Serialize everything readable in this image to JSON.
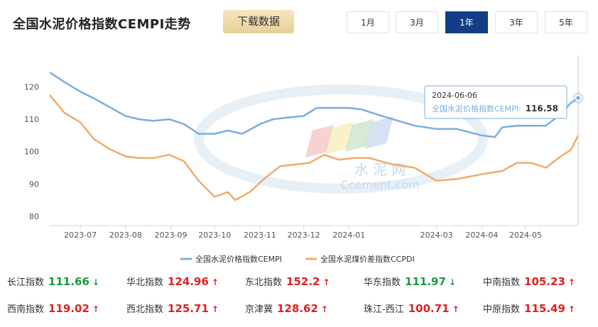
{
  "header": {
    "title": "全国水泥价格指数CEMPI走势",
    "download_label": "下载数据",
    "ranges": [
      "1月",
      "3月",
      "1年",
      "3年",
      "5年"
    ],
    "active_range": "1年"
  },
  "colors": {
    "cempi": "#7aaee0",
    "ccpdi": "#f0ac6c",
    "up": "#e02020",
    "down": "#1a9a3c",
    "accent": "#123e85"
  },
  "chart_data": {
    "type": "line",
    "ylim": [
      78,
      128
    ],
    "yticks": [
      80,
      90,
      100,
      110,
      120
    ],
    "xticks": [
      "2023-07",
      "2023-08",
      "2023-09",
      "2023-10",
      "2023-11",
      "2023-12",
      "2024-01",
      "2024-03",
      "2024-04",
      "2024-05"
    ],
    "series": [
      {
        "name": "全国水泥价格指数CEMPI",
        "color": "#7aaee0",
        "points": [
          [
            "2023-06-10",
            124.5
          ],
          [
            "2023-06-20",
            121.5
          ],
          [
            "2023-07-01",
            118.5
          ],
          [
            "2023-07-10",
            116.5
          ],
          [
            "2023-07-20",
            114
          ],
          [
            "2023-08-01",
            111
          ],
          [
            "2023-08-10",
            110
          ],
          [
            "2023-08-20",
            109.5
          ],
          [
            "2023-08-31",
            110
          ],
          [
            "2023-09-10",
            108.5
          ],
          [
            "2023-09-20",
            105.5
          ],
          [
            "2023-10-01",
            105.5
          ],
          [
            "2023-10-10",
            106.5
          ],
          [
            "2023-10-20",
            105.5
          ],
          [
            "2023-11-01",
            108.5
          ],
          [
            "2023-11-10",
            110
          ],
          [
            "2023-11-20",
            110.5
          ],
          [
            "2023-12-01",
            111
          ],
          [
            "2023-12-10",
            113.5
          ],
          [
            "2023-12-20",
            113.5
          ],
          [
            "2024-01-01",
            113.5
          ],
          [
            "2024-01-10",
            113
          ],
          [
            "2024-01-20",
            111.5
          ],
          [
            "2024-01-31",
            110
          ],
          [
            "2024-02-15",
            108
          ],
          [
            "2024-03-01",
            107
          ],
          [
            "2024-03-15",
            107
          ],
          [
            "2024-04-01",
            105
          ],
          [
            "2024-04-10",
            104.5
          ],
          [
            "2024-04-15",
            107.5
          ],
          [
            "2024-04-25",
            108
          ],
          [
            "2024-05-05",
            108
          ],
          [
            "2024-05-15",
            108
          ],
          [
            "2024-05-25",
            111.5
          ],
          [
            "2024-06-01",
            115
          ],
          [
            "2024-06-06",
            116.58
          ]
        ]
      },
      {
        "name": "全国水泥煤价差指数CCPDI",
        "color": "#f0ac6c",
        "points": [
          [
            "2023-06-10",
            117.5
          ],
          [
            "2023-06-20",
            112
          ],
          [
            "2023-07-01",
            109
          ],
          [
            "2023-07-10",
            104
          ],
          [
            "2023-07-20",
            101
          ],
          [
            "2023-08-01",
            98.5
          ],
          [
            "2023-08-10",
            98
          ],
          [
            "2023-08-20",
            98
          ],
          [
            "2023-08-31",
            99
          ],
          [
            "2023-09-10",
            97
          ],
          [
            "2023-09-20",
            91
          ],
          [
            "2023-10-01",
            86
          ],
          [
            "2023-10-10",
            87.5
          ],
          [
            "2023-10-15",
            85
          ],
          [
            "2023-10-25",
            87.5
          ],
          [
            "2023-11-05",
            92
          ],
          [
            "2023-11-15",
            95.5
          ],
          [
            "2023-11-25",
            96
          ],
          [
            "2023-12-05",
            96.5
          ],
          [
            "2023-12-15",
            99
          ],
          [
            "2023-12-25",
            97.5
          ],
          [
            "2024-01-05",
            98
          ],
          [
            "2024-01-15",
            98
          ],
          [
            "2024-01-31",
            96
          ],
          [
            "2024-02-15",
            95
          ],
          [
            "2024-03-01",
            91
          ],
          [
            "2024-03-15",
            91.5
          ],
          [
            "2024-04-01",
            93
          ],
          [
            "2024-04-15",
            94
          ],
          [
            "2024-04-25",
            96.5
          ],
          [
            "2024-05-05",
            96.5
          ],
          [
            "2024-05-15",
            95
          ],
          [
            "2024-05-25",
            98.5
          ],
          [
            "2024-06-01",
            100.5
          ],
          [
            "2024-06-06",
            105
          ]
        ]
      }
    ],
    "tooltip": {
      "date": "2024-06-06",
      "label": "全国水泥价格指数CEMPI:",
      "value": "116.58"
    },
    "watermark": {
      "cn": "水 泥 网",
      "en": "Ccement.com"
    },
    "legend_position": "bottom-center",
    "grid": false
  },
  "stats": [
    {
      "name": "长江指数",
      "value": "111.66",
      "dir": "down"
    },
    {
      "name": "华北指数",
      "value": "124.96",
      "dir": "up"
    },
    {
      "name": "东北指数",
      "value": "152.2",
      "dir": "up"
    },
    {
      "name": "华东指数",
      "value": "111.97",
      "dir": "down"
    },
    {
      "name": "中南指数",
      "value": "105.23",
      "dir": "up"
    },
    {
      "name": "西南指数",
      "value": "119.02",
      "dir": "up"
    },
    {
      "name": "西北指数",
      "value": "125.71",
      "dir": "up"
    },
    {
      "name": "京津冀",
      "value": "128.62",
      "dir": "up"
    },
    {
      "name": "珠江-西江",
      "value": "100.71",
      "dir": "up"
    },
    {
      "name": "中原指数",
      "value": "115.49",
      "dir": "up"
    }
  ]
}
